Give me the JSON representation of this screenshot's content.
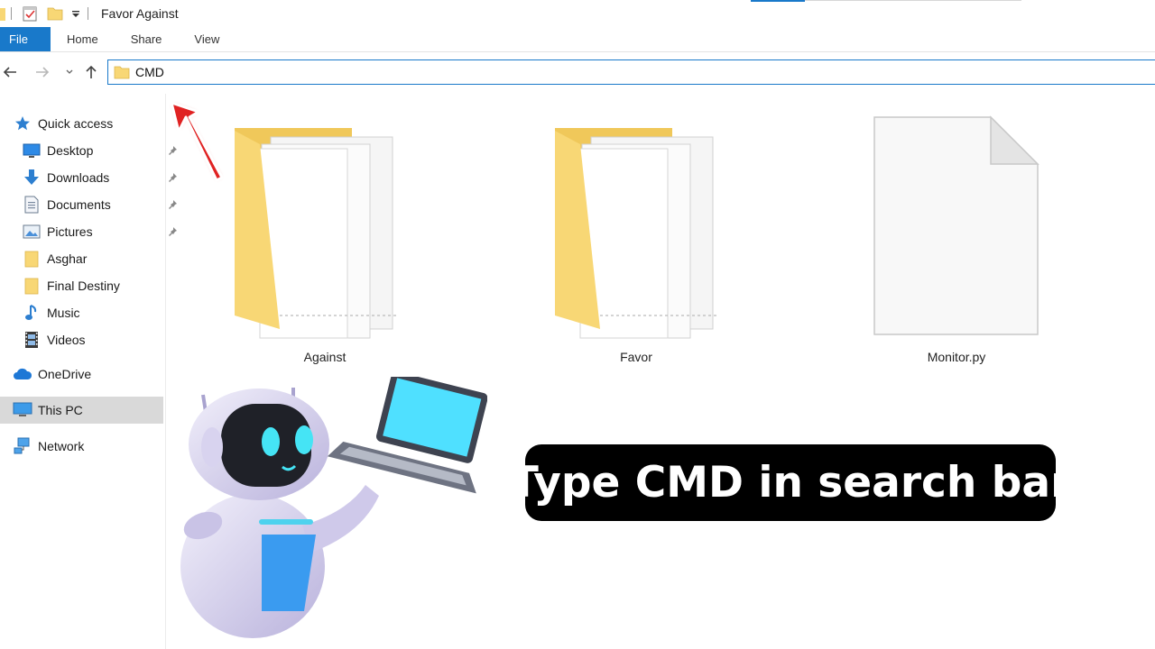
{
  "window": {
    "title": "Favor Against"
  },
  "ribbon": {
    "tabs": [
      "File",
      "Home",
      "Share",
      "View"
    ]
  },
  "address_bar": {
    "value": "CMD"
  },
  "sidebar": {
    "quick_access": "Quick access",
    "pinned": [
      "Desktop",
      "Downloads",
      "Documents",
      "Pictures"
    ],
    "folders": [
      "Asghar",
      "Final Destiny",
      "Music",
      "Videos"
    ],
    "onedrive": "OneDrive",
    "this_pc": "This PC",
    "network": "Network"
  },
  "content": {
    "items": [
      {
        "name": "Against",
        "type": "folder"
      },
      {
        "name": "Favor",
        "type": "folder"
      },
      {
        "name": "Monitor.py",
        "type": "file"
      }
    ]
  },
  "overlay": {
    "caption": "Type CMD in search bar",
    "arrow_color": "#e02020"
  },
  "colors": {
    "accent": "#1979ca",
    "folder": "#f8d775"
  }
}
